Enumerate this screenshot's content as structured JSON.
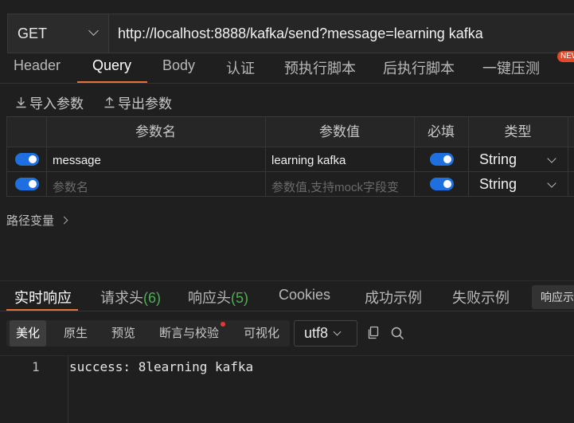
{
  "request": {
    "method": "GET",
    "url": "http://localhost:8888/kafka/send?message=learning kafka"
  },
  "tabs": [
    "Header",
    "Query",
    "Body",
    "认证",
    "预执行脚本",
    "后执行脚本",
    "一键压测"
  ],
  "active_tab": "Query",
  "new_badge": "NEW",
  "tools": {
    "import": "导入参数",
    "export": "导出参数"
  },
  "table": {
    "headers": {
      "name": "参数名",
      "value": "参数值",
      "required": "必填",
      "type": "类型"
    },
    "rows": [
      {
        "enabled": true,
        "name": "message",
        "value": "learning kafka",
        "required": true,
        "type": "String"
      },
      {
        "enabled": true,
        "name_placeholder": "参数名",
        "value_placeholder": "参数值,支持mock字段变",
        "required": true,
        "type": "String"
      }
    ]
  },
  "path_vars": "路径变量",
  "response": {
    "tabs": [
      {
        "label": "实时响应",
        "count": ""
      },
      {
        "label": "请求头",
        "count": "(6)"
      },
      {
        "label": "响应头",
        "count": "(5)"
      },
      {
        "label": "Cookies",
        "count": ""
      },
      {
        "label": "成功示例",
        "count": ""
      },
      {
        "label": "失败示例",
        "count": ""
      }
    ],
    "side_button": "响应示例",
    "view_tabs": [
      "美化",
      "原生",
      "预览",
      "断言与校验",
      "可视化"
    ],
    "encoding": "utf8",
    "code_lines": [
      {
        "num": "1",
        "text": "success: 8learning kafka"
      }
    ]
  },
  "colors": {
    "accent": "#e8703a",
    "toggle": "#1e6fe0",
    "count": "#4caf50"
  }
}
